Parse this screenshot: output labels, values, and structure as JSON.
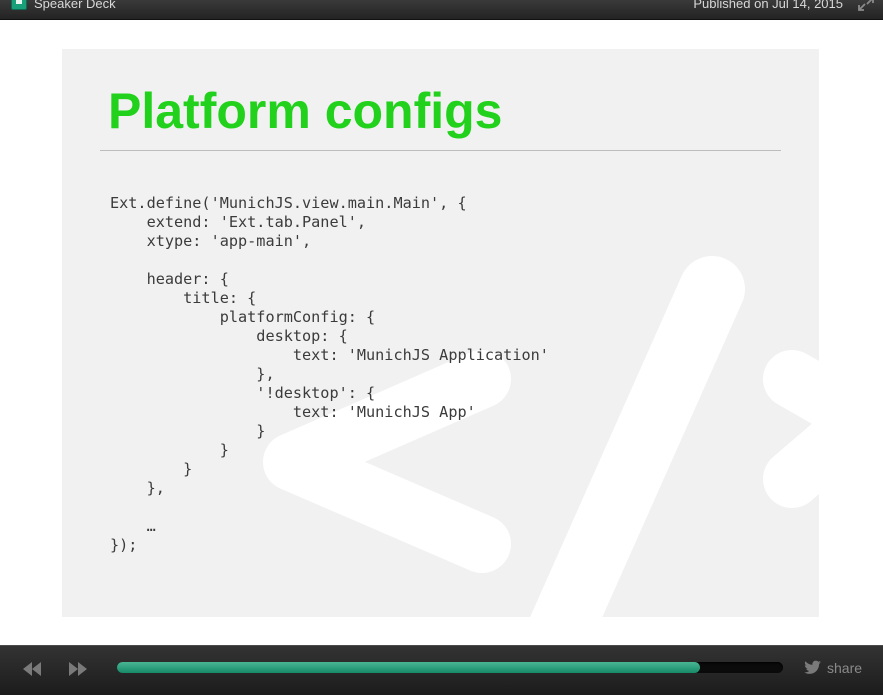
{
  "topbar": {
    "brand": "Speaker Deck",
    "published": "Published on Jul 14, 2015"
  },
  "slide": {
    "title": "Platform configs",
    "code_lines": [
      "Ext.define('MunichJS.view.main.Main', {",
      "    extend: 'Ext.tab.Panel',",
      "    xtype: 'app-main',",
      "",
      "    header: {",
      "        title: {",
      "            platformConfig: {",
      "                desktop: {",
      "                    text: 'MunichJS Application'",
      "                },",
      "                '!desktop': {",
      "                    text: 'MunichJS App'",
      "                }",
      "            }",
      "        }",
      "    },",
      "",
      "    …",
      "});"
    ]
  },
  "controls": {
    "progress_fraction": 0.875,
    "share_label": "share"
  },
  "colors": {
    "title": "#21d11b",
    "progress": "#2aa07a",
    "brand_logo": "#17a07a"
  }
}
